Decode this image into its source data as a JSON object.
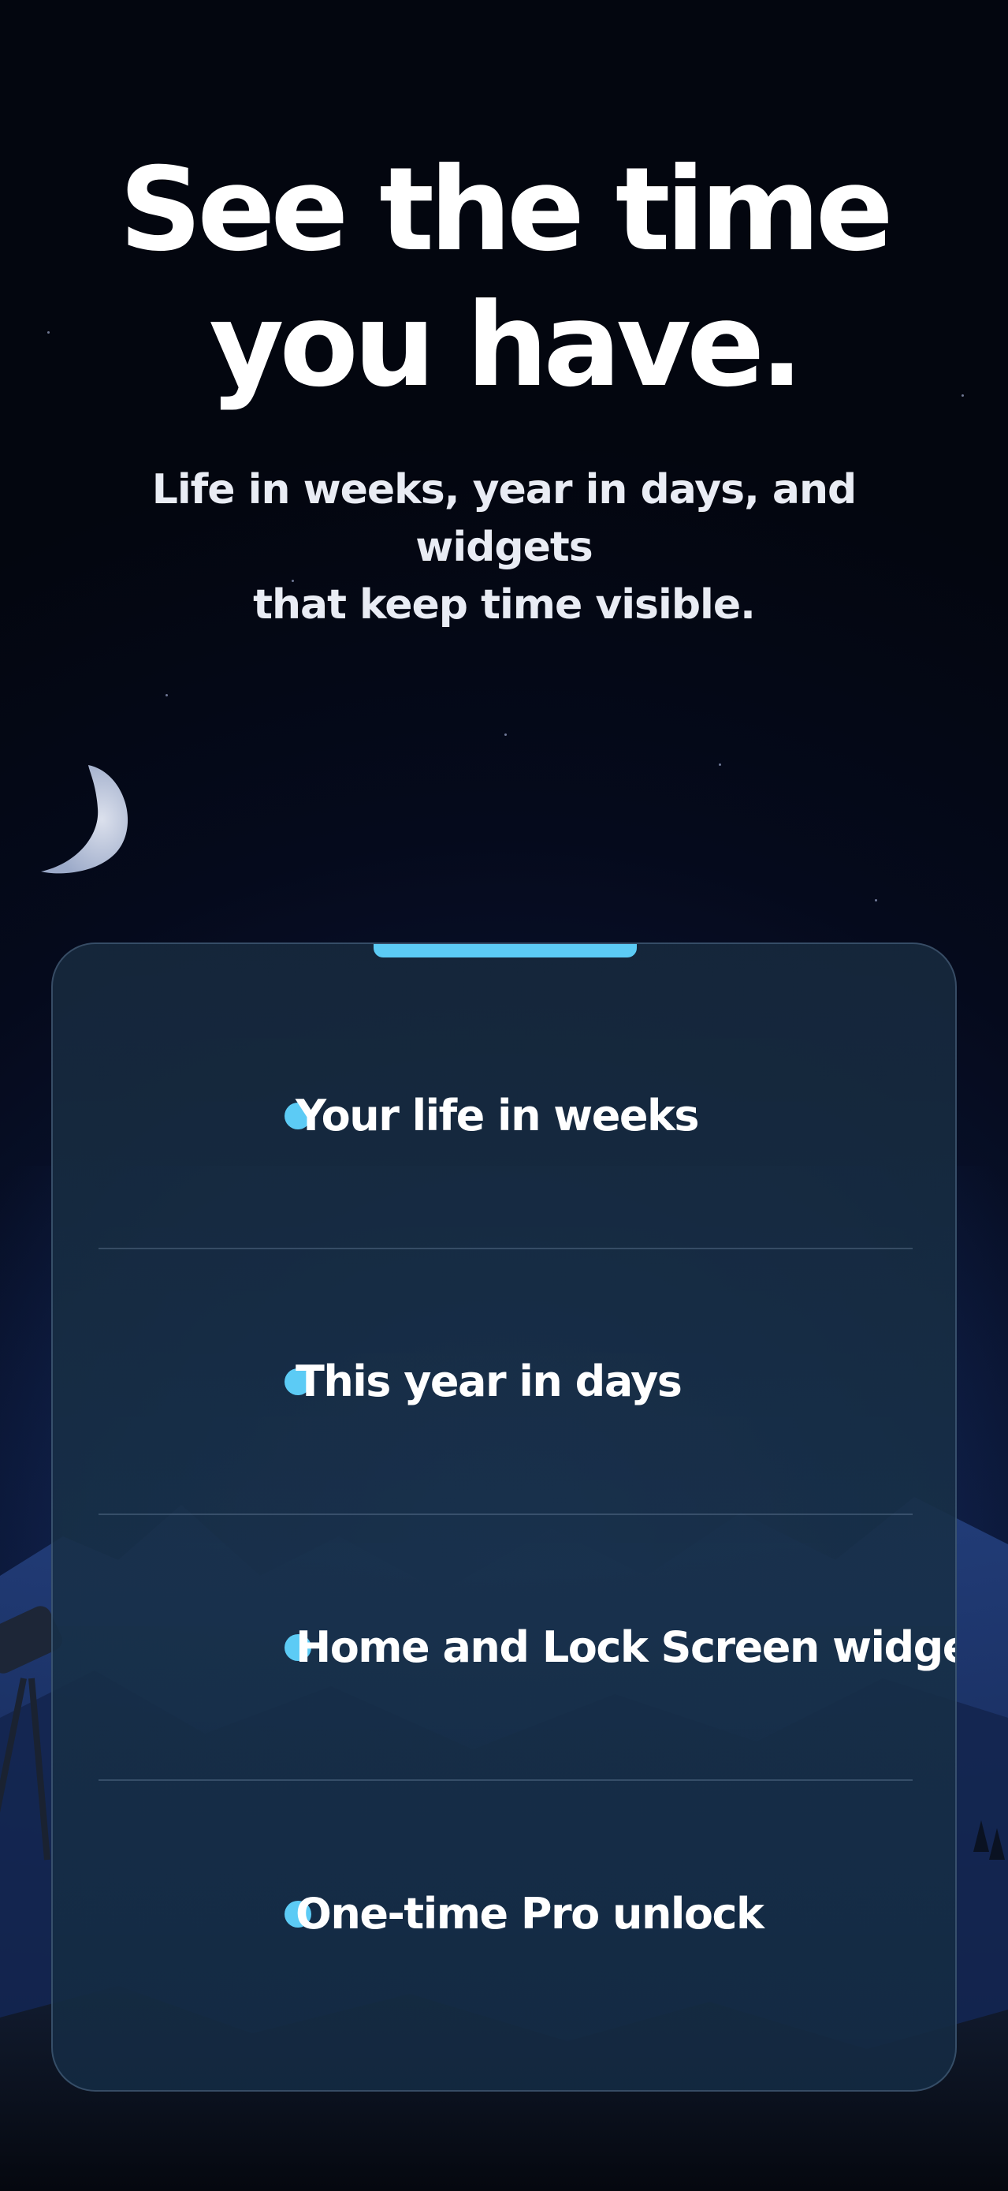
{
  "headline": {
    "line1": "See the time",
    "line2": "you have."
  },
  "subtitle": {
    "line1": "Life in weeks, year in days, and widgets",
    "line2": "that keep time visible."
  },
  "features": [
    {
      "label": "Your life in weeks",
      "icon": "bullet-dot-icon"
    },
    {
      "label": "This year in days",
      "icon": "bullet-dot-icon"
    },
    {
      "label": "Home and Lock Screen widgets",
      "icon": "bullet-dot-icon"
    },
    {
      "label": "One-time Pro unlock",
      "icon": "bullet-dot-icon"
    }
  ],
  "colors": {
    "accent": "#5ccbf5",
    "background": "#050a1c",
    "card": "#182a3e",
    "text": "#ffffff"
  }
}
